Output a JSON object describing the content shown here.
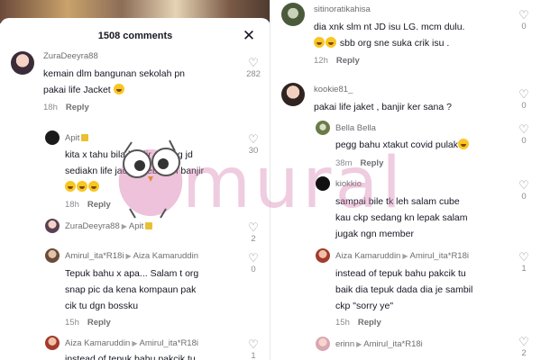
{
  "header": {
    "comment_count": "1508 comments"
  },
  "watermark": {
    "text": "mural"
  },
  "left_comments": [
    {
      "username": "ZuraDeeyra88",
      "lines": [
        "kemain dlm bangunan sekolah pn",
        "pakai life Jacket"
      ],
      "emoji_count": 1,
      "time": "18h",
      "reply": "Reply",
      "likes": "282"
    },
    {
      "username": "Apit",
      "lines": [
        "kita x tahu bila banjir datang jd",
        "sediakn life jacket sebelum banjir"
      ],
      "emoji_count": 3,
      "time": "18h",
      "reply": "Reply",
      "likes": "30"
    },
    {
      "username": "ZuraDeeyra88",
      "reply_to": "Apit",
      "lines": [],
      "time": "",
      "reply": "",
      "likes": "2"
    },
    {
      "username": "Amirul_ita*R18i",
      "reply_to": "Aiza Kamaruddin",
      "lines": [
        "Tepuk bahu x apa... Salam t org",
        "snap pic da kena kompaun pak",
        "cik tu dgn bossku"
      ],
      "time": "15h",
      "reply": "Reply",
      "likes": "0"
    },
    {
      "username": "Aiza Kamaruddin",
      "reply_to": "Amirul_ita*R18i",
      "lines": [
        "instead of tepuk bahu pakcik tu"
      ],
      "time": "",
      "reply": "",
      "likes": "1"
    }
  ],
  "right_comments": [
    {
      "username": "sitinoratikahisa",
      "lines": [
        "dia xnk slm nt JD isu LG. mcm dulu.",
        "sbb org sne suka crik isu ."
      ],
      "emoji_count": 2,
      "time": "12h",
      "reply": "Reply",
      "likes": "0"
    },
    {
      "username": "kookie81_",
      "lines": [
        "pakai life jaket , banjir ker sana ?"
      ],
      "time": "",
      "reply": "",
      "likes": "0"
    },
    {
      "username": "Bella Bella",
      "lines": [
        "pegg bahu xtakut covid pulak"
      ],
      "emoji_count": 1,
      "time": "38m",
      "reply": "Reply",
      "likes": "0"
    },
    {
      "username": "kiokkio",
      "lines": [
        "sampai bile tk leh salam cube",
        "kau ckp sedang kn lepak salam",
        "jugak ngn member"
      ],
      "time": "",
      "reply": "",
      "likes": "0"
    },
    {
      "username": "Aiza Kamaruddin",
      "reply_to": "Amirul_ita*R18i",
      "lines": [
        "instead of tepuk bahu pakcik tu",
        "baik dia tepuk dada dia je sambil",
        "ckp \"sorry ye\""
      ],
      "time": "15h",
      "reply": "Reply",
      "likes": "1"
    },
    {
      "username": "erinn",
      "reply_to": "Amirul_ita*R18i",
      "lines": [],
      "time": "",
      "reply": "",
      "likes": "2"
    }
  ],
  "colors": {
    "accent_watermark": "#d478ac",
    "muted_text": "#8a8b91",
    "primary_text": "#161823"
  },
  "icons": {
    "like": "heart-outline-icon",
    "close": "close-icon",
    "reply_arrow": "triangle-right-icon"
  }
}
